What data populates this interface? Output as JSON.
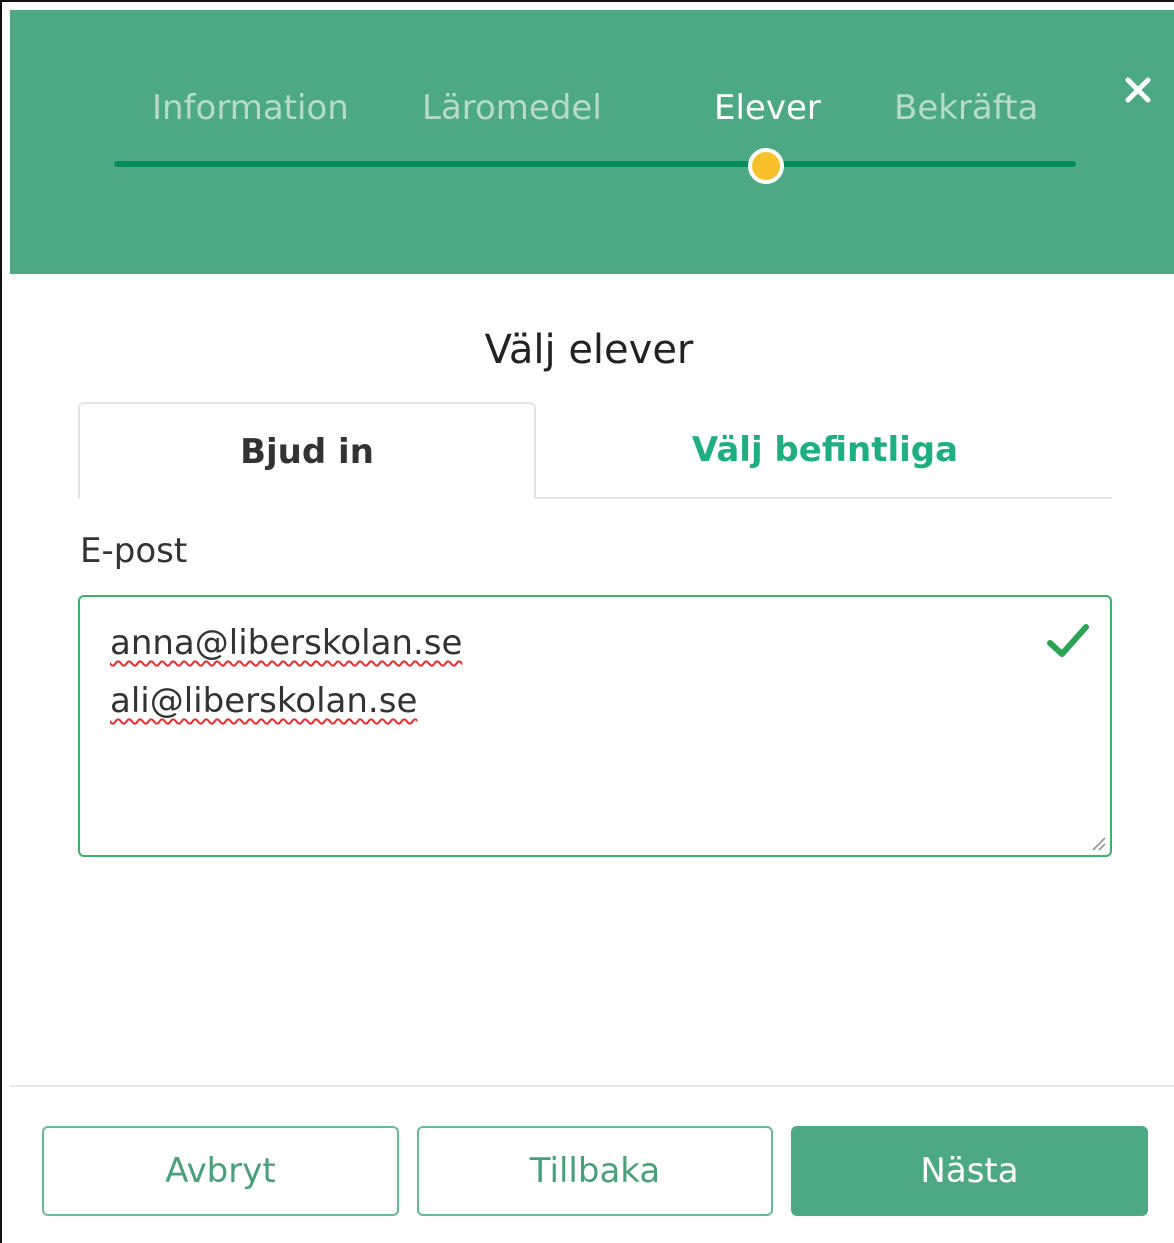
{
  "steps": [
    {
      "label": "Information",
      "state": "completed"
    },
    {
      "label": "Läromedel",
      "state": "completed"
    },
    {
      "label": "Elever",
      "state": "active"
    },
    {
      "label": "Bekräfta",
      "state": "upcoming"
    }
  ],
  "close_icon": "close-icon",
  "title": "Välj elever",
  "tabs": {
    "invite": "Bjud in",
    "existing": "Välj befintliga"
  },
  "email": {
    "label": "E-post",
    "lines": [
      "anna@liberskolan.se",
      "ali@liberskolan.se"
    ],
    "valid_icon": "checkmark-icon"
  },
  "footer": {
    "cancel": "Avbryt",
    "back": "Tillbaka",
    "next": "Nästa"
  },
  "colors": {
    "header": "#4da884",
    "accent": "#1fae80",
    "progress": "#068c5e",
    "progress_marker": "#f8c12c",
    "valid": "#2aa353"
  }
}
